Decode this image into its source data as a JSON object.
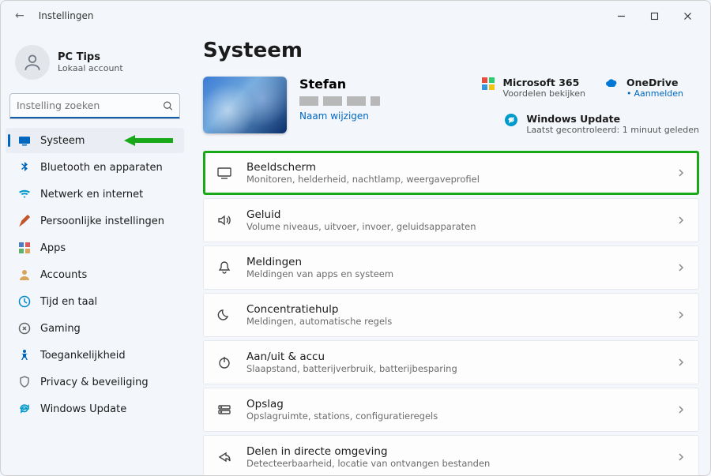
{
  "title": "Instellingen",
  "account": {
    "name": "PC Tips",
    "sub": "Lokaal account"
  },
  "search": {
    "placeholder": "Instelling zoeken"
  },
  "sidebar": [
    {
      "label": "Systeem"
    },
    {
      "label": "Bluetooth en apparaten"
    },
    {
      "label": "Netwerk en internet"
    },
    {
      "label": "Persoonlijke instellingen"
    },
    {
      "label": "Apps"
    },
    {
      "label": "Accounts"
    },
    {
      "label": "Tijd en taal"
    },
    {
      "label": "Gaming"
    },
    {
      "label": "Toegankelijkheid"
    },
    {
      "label": "Privacy & beveiliging"
    },
    {
      "label": "Windows Update"
    }
  ],
  "page_title": "Systeem",
  "pc": {
    "name": "Stefan",
    "rename": "Naam wijzigen"
  },
  "cloud": {
    "m365": {
      "title": "Microsoft 365",
      "sub": "Voordelen bekijken"
    },
    "onedrive": {
      "title": "OneDrive",
      "sub": "Aanmelden"
    },
    "update": {
      "title": "Windows Update",
      "sub": "Laatst gecontroleerd: 1 minuut geleden"
    }
  },
  "settings": [
    {
      "title": "Beeldscherm",
      "sub": "Monitoren, helderheid, nachtlamp, weergaveprofiel"
    },
    {
      "title": "Geluid",
      "sub": "Volume niveaus, uitvoer, invoer, geluidsapparaten"
    },
    {
      "title": "Meldingen",
      "sub": "Meldingen van apps en systeem"
    },
    {
      "title": "Concentratiehulp",
      "sub": "Meldingen, automatische regels"
    },
    {
      "title": "Aan/uit & accu",
      "sub": "Slaapstand, batterijverbruik, batterijbesparing"
    },
    {
      "title": "Opslag",
      "sub": "Opslagruimte, stations, configuratieregels"
    },
    {
      "title": "Delen in directe omgeving",
      "sub": "Detecteerbaarheid, locatie van ontvangen bestanden"
    }
  ]
}
